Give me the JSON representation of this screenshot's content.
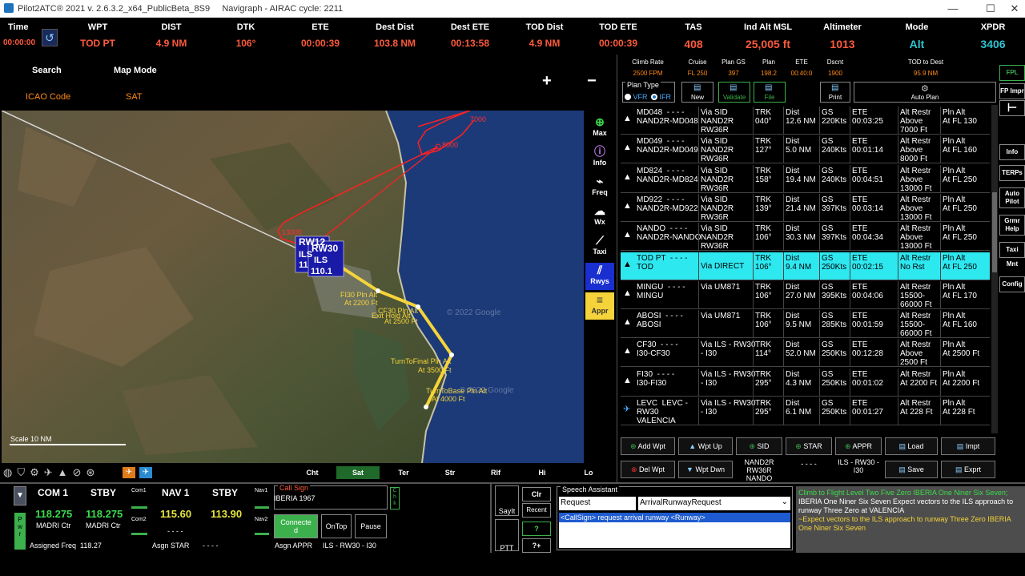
{
  "title_bar": {
    "title": "Pilot2ATC® 2021 v. 2.6.3.2_x64_PublicBeta_8S9",
    "navigraph": "Navigraph - AIRAC cycle: 2211"
  },
  "top": {
    "time_label": "Time",
    "time_value": "00:00:00",
    "fields": [
      {
        "label": "WPT",
        "value": "TOD PT"
      },
      {
        "label": "DIST",
        "value": "4.9 NM"
      },
      {
        "label": "DTK",
        "value": "106°"
      },
      {
        "label": "ETE",
        "value": "00:00:39"
      },
      {
        "label": "Dest Dist",
        "value": "103.8 NM"
      },
      {
        "label": "Dest ETE",
        "value": "00:13:58"
      },
      {
        "label": "TOD Dist",
        "value": "4.9 NM"
      },
      {
        "label": "TOD ETE",
        "value": "00:00:39"
      },
      {
        "label": "TAS",
        "value": "408"
      },
      {
        "label": "Ind Alt MSL",
        "value": "25,005 ft"
      },
      {
        "label": "Altimeter",
        "value": "1013"
      },
      {
        "label": "Mode",
        "value": "Alt"
      },
      {
        "label": "XPDR",
        "value": "3406"
      }
    ]
  },
  "map_panel": {
    "search": "Search",
    "map_mode": "Map Mode",
    "icao_code": "ICAO Code",
    "sat": "SAT",
    "plus": "+",
    "minus": "−",
    "scale": "Scale 10 NM",
    "watermark1": "© 2022 Google",
    "watermark2": "© 2022 Google"
  },
  "map_labels": {
    "rw12": "RW12",
    "rw30": "RW30",
    "ils_a": "ILS",
    "ils_b": "ILS",
    "freq_a": "11",
    "freq_b": "110.1",
    "fi30": "FI30 Pln Alt",
    "fi30_alt": "At 2200 Ft",
    "cf30": "CF30 Pln Alt",
    "exit_hold": "Exit Hold Alt",
    "cf30_alt": "At 2500 Ft",
    "ttf": "TurnToFinal Pln Alt",
    "ttf_alt": "At 3500 Ft",
    "ttb": "TurnToBase Pln Alt",
    "ttb_alt": "At 4000 Ft",
    "r1": "7000",
    "r2": "8000",
    "r3": "13000",
    "r4": "ILS",
    "r5": "R30"
  },
  "side_buttons": [
    "Max",
    "Info",
    "Freq",
    "Wx",
    "Taxi",
    "Rwys",
    "Appr"
  ],
  "map_tabs": [
    "Cht",
    "Sat",
    "Ter",
    "Str",
    "Rlf",
    "Hi",
    "Lo"
  ],
  "fpl_header": {
    "climb_rate": "Climb Rate",
    "climb_rate_v": "2500 FPM",
    "cruise": "Cruise",
    "cruise_v": "FL 250",
    "plan_gs": "Plan GS",
    "plan_gs_v": "397",
    "plan": "Plan",
    "plan_v": "198.2",
    "ete": "ETE",
    "ete_v": "00:40:0",
    "dscnt": "Dscnt",
    "dscnt_v": "1900",
    "tod": "TOD to Dest",
    "tod_v": "95.9 NM",
    "plan_type": "Plan Type",
    "vfr": "VFR",
    "ifr": "IFR",
    "new": "New",
    "validate": "Validate",
    "file": "File",
    "print": "Print",
    "auto_plan": "Auto Plan"
  },
  "fpl_rows": [
    {
      "wpt": "MD048  - - - -\nNAND2R-MD048",
      "via": "Via SID\nNAND2R\nRW36R",
      "trk": "TRK\n040°",
      "dist": "Dist\n12.6 NM",
      "gs": "GS\n220Kts",
      "ete": "ETE\n00:03:25",
      "alt": "Alt Restr\nAbove\n7000 Ft",
      "pln": "Pln Alt\nAt FL 130"
    },
    {
      "wpt": "MD049  - - - -\nNAND2R-MD049",
      "via": "Via SID\nNAND2R\nRW36R",
      "trk": "TRK\n127°",
      "dist": "Dist\n5.0 NM",
      "gs": "GS\n240Kts",
      "ete": "ETE\n00:01:14",
      "alt": "Alt Restr\nAbove\n8000 Ft",
      "pln": "Pln Alt\nAt FL 160"
    },
    {
      "wpt": "MD824  - - - -\nNAND2R-MD824",
      "via": "Via SID\nNAND2R\nRW36R",
      "trk": "TRK\n158°",
      "dist": "Dist\n19.4 NM",
      "gs": "GS\n240Kts",
      "ete": "ETE\n00:04:51",
      "alt": "Alt Restr\nAbove\n13000 Ft",
      "pln": "Pln Alt\nAt FL 250"
    },
    {
      "wpt": "MD922  - - - -\nNAND2R-MD922",
      "via": "Via SID\nNAND2R\nRW36R",
      "trk": "TRK\n139°",
      "dist": "Dist\n21.4 NM",
      "gs": "GS\n397Kts",
      "ete": "ETE\n00:03:14",
      "alt": "Alt Restr\nAbove\n13000 Ft",
      "pln": "Pln Alt\nAt FL 250"
    },
    {
      "wpt": "NANDO  - - - -\nNAND2R-NANDO",
      "via": "Via SID\nNAND2R\nRW36R",
      "trk": "TRK\n106°",
      "dist": "Dist\n30.3 NM",
      "gs": "GS\n397Kts",
      "ete": "ETE\n00:04:34",
      "alt": "Alt Restr\nAbove\n13000 Ft",
      "pln": "Pln Alt\nAt FL 250"
    },
    {
      "wpt": "TOD PT  - - - -\nTOD",
      "via": "Via DIRECT",
      "trk": "TRK\n106°",
      "dist": "Dist\n9.4 NM",
      "gs": "GS\n250Kts",
      "ete": "ETE\n00:02:15",
      "alt": "Alt Restr\nNo Rst",
      "pln": "Pln Alt\nAt FL 250"
    },
    {
      "wpt": "MINGU  - - - -\nMINGU",
      "via": "Via UM871",
      "trk": "TRK\n106°",
      "dist": "Dist\n27.0 NM",
      "gs": "GS\n395Kts",
      "ete": "ETE\n00:04:06",
      "alt": "Alt Restr\n15500-\n66000 Ft",
      "pln": "Pln Alt\nAt FL 170"
    },
    {
      "wpt": "ABOSI  - - - -\nABOSI",
      "via": "Via UM871",
      "trk": "TRK\n106°",
      "dist": "Dist\n9.5 NM",
      "gs": "GS\n285Kts",
      "ete": "ETE\n00:01:59",
      "alt": "Alt Restr\n15500-\n66000 Ft",
      "pln": "Pln Alt\nAt FL 160"
    },
    {
      "wpt": "CF30  - - - -\nI30-CF30",
      "via": "Via ILS - RW30\n- I30",
      "trk": "TRK\n114°",
      "dist": "Dist\n52.0 NM",
      "gs": "GS\n250Kts",
      "ete": "ETE\n00:12:28",
      "alt": "Alt Restr\nAbove\n2500 Ft",
      "pln": "Pln Alt\nAt 2500 Ft"
    },
    {
      "wpt": "FI30  - - - -\nI30-FI30",
      "via": "Via ILS - RW30\n- I30",
      "trk": "TRK\n295°",
      "dist": "Dist\n4.3 NM",
      "gs": "GS\n250Kts",
      "ete": "ETE\n00:01:02",
      "alt": "Alt Restr\nAt 2200 Ft",
      "pln": "Pln Alt\nAt 2200 Ft"
    },
    {
      "wpt": "LEVC  LEVC -\nRW30\nVALENCIA",
      "via": "Via ILS - RW30\n- I30",
      "trk": "TRK\n295°",
      "dist": "Dist\n6.1 NM",
      "gs": "GS\n250Kts",
      "ete": "ETE\n00:01:27",
      "alt": "Alt Restr\nAt 228 Ft",
      "pln": "Pln Alt\nAt 228 Ft"
    }
  ],
  "fpl_buttons": {
    "add_wpt": "Add Wpt",
    "wpt_up": "Wpt Up",
    "sid": "SID",
    "star": "STAR",
    "appr": "APPR",
    "load": "Load",
    "impt": "Impt",
    "del_wpt": "Del Wpt",
    "wpt_dwn": "Wpt Dwn",
    "sid_v": "NAND2R\nRW36R\nNANDO",
    "star_v": "- - - -",
    "appr_v": "ILS - RW30 -\nI30",
    "save": "Save",
    "exprt": "Exprt"
  },
  "right_buttons": [
    "FPL",
    "FP Impr",
    "",
    "Info",
    "TERPs",
    "Auto\nPilot",
    "Grmr\nHelp",
    "Taxi Mnt",
    "Config"
  ],
  "radio": {
    "com1": "COM 1",
    "stby1": "STBY",
    "com1_small": "Com1",
    "com2_small": "Com2",
    "com1_freq": "118.275",
    "com1_stby": "118.275",
    "com1_name": "MADRI Ctr",
    "com1_stby_name": "MADRI Ctr",
    "nav1": "NAV 1",
    "stby2": "STBY",
    "nav1_freq": "115.60",
    "nav1_stby": "113.90",
    "nav1_small": "Nav1",
    "nav2_small": "Nav2",
    "nav_dash1": "- - - -",
    "nav_dash2": "- - - -",
    "assigned_freq_label": "Assigned Freq",
    "assigned_freq": "118.27",
    "asgn_star_label": "Asgn STAR",
    "asgn_star": "- - - -",
    "pwr": "P\nw\nr"
  },
  "callsign": {
    "label": "Call Sign",
    "value": "IBERIA 1967",
    "chk": "C\nh\nk",
    "connected": "Connecte\nd",
    "ontop": "OnTop",
    "pause": "Pause",
    "asgn_appr_label": "Asgn APPR",
    "asgn_appr": "ILS - RW30 - I30"
  },
  "speech": {
    "saylt": "SayIt",
    "ptt": "PTT",
    "clr": "Clr",
    "recent": "Recent",
    "q": "?",
    "qplus": "?+",
    "title": "Speech Assistant",
    "sel1": "Request",
    "sel2": "ArrivalRunwayRequest",
    "item": "<CallSign> request arrival runway <Runway>"
  },
  "log": {
    "l1": "Climb to Flight Level Two Five Zero IBERIA One Niner Six Seven;",
    "l2": "IBERIA One Niner Six Seven Expect vectors to the  ILS  approach to runway Three Zero at VALENCIA",
    "l3": "~Expect vectors to the  ILS  approach to runway Three Zero IBERIA One Niner Six Seven"
  },
  "colors": {
    "accent_red": "#ff5a3c",
    "teal": "#2fc3d0",
    "highlight": "#2ee8f0",
    "route_yellow": "#f5d33a",
    "route_red": "#ff2020",
    "green": "#3cb04c"
  }
}
